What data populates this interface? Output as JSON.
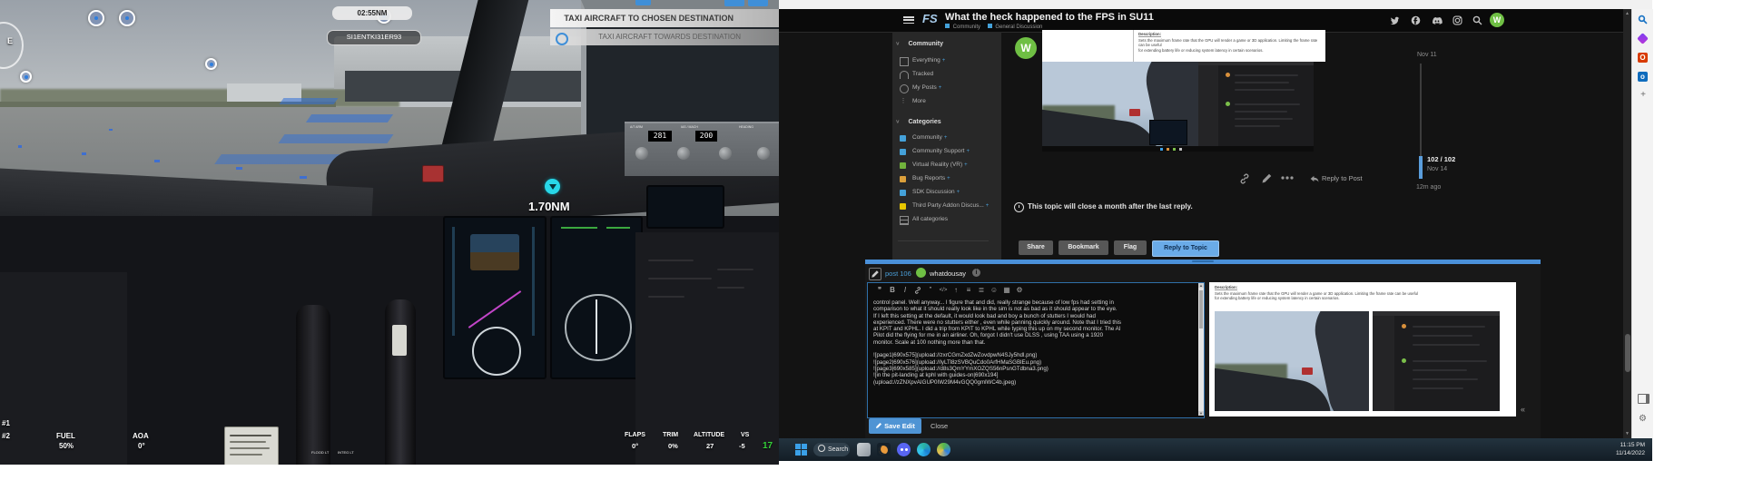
{
  "colors": {
    "accent_blue": "#4a9fd8",
    "category_blue": "#44a1d9",
    "category_green": "#71b33c",
    "category_orange": "#dba03b",
    "category_yellow": "#e7c600",
    "avatar_green": "#6fbf44",
    "reply_button_blue": "#6aabe8",
    "composer_bar_blue": "#4a90d9",
    "taskbar_bg": "#1d2a35",
    "fps_green": "#35d23a"
  },
  "sim": {
    "poi_pill": "02:55NM",
    "route_pill": "SI1ENTKI31ER93",
    "banner_primary": "TAXI AIRCRAFT TO CHOSEN DESTINATION",
    "banner_secondary": "TAXI AIRCRAFT TOWARDS DESTINATION",
    "distance_label": "1.70NM",
    "compass_letter": "E",
    "mcp_course": "281",
    "mcp_ias": "200",
    "mcp_label_1": "A/T ARM",
    "mcp_label_2": "IAS / MACH",
    "mcp_label_3": "HEADING",
    "hud": {
      "flaps_label": "FLAPS",
      "flaps_value": "0°",
      "trim_label": "TRIM",
      "trim_value": "0%",
      "altitude_label": "ALTITUDE",
      "altitude_value": "27",
      "vs_label": "VS",
      "vs_value": "-5"
    },
    "fps_counter": "17",
    "engine1": "#1",
    "engine2": "#2",
    "fuel_label": "FUEL",
    "fuel_value": "50%",
    "aoa_label": "AOA",
    "aoa_value": "0°",
    "panel_flood": "FLOOD LT",
    "panel_integ": "INTEG LT"
  },
  "browser": {
    "header": {
      "logo": "FS",
      "title": "What the heck happened to the FPS in SU11",
      "tag1": "Community",
      "tag2": "General Discussion",
      "avatar_letter": "W"
    },
    "sidebar": {
      "section1_header": "Community",
      "items1": [
        {
          "label": "Everything",
          "suffix": "+"
        },
        {
          "label": "Tracked",
          "suffix": ""
        },
        {
          "label": "My Posts",
          "suffix": "+"
        },
        {
          "label": "More",
          "suffix": ""
        }
      ],
      "section2_header": "Categories",
      "items2": [
        {
          "label": "Community",
          "suffix": "+"
        },
        {
          "label": "Community Support",
          "suffix": "+"
        },
        {
          "label": "Virtual Reality (VR)",
          "suffix": "+"
        },
        {
          "label": "Bug Reports",
          "suffix": "+"
        },
        {
          "label": "SDK Discussion",
          "suffix": "+"
        },
        {
          "label": "Third Party Addon Discus...",
          "suffix": "+"
        },
        {
          "label": "All categories",
          "suffix": ""
        }
      ]
    },
    "post": {
      "avatar_letter": "W",
      "description_heading": "Description:",
      "description_text": "Sets the maximum frame rate that the GPU will render a game or 3D application. Limiting the frame rate can be useful\nfor extending battery life or reducing system latency in certain scenarios.",
      "reply_label": "Reply to Post"
    },
    "notice": "This topic will close a month after the last reply.",
    "topic_buttons": {
      "share": "Share",
      "bookmark": "Bookmark",
      "flag": "Flag",
      "reply": "Reply to Topic"
    },
    "timeline": {
      "start_date": "Nov 11",
      "progress": "102 / 102",
      "end_date": "Nov 14",
      "last_activity": "12m ago"
    },
    "composer": {
      "badge": "post 106",
      "username": "whatdousay",
      "body": "control panel. Well anyway... I figure that and did, really strange because of low fps had setting in\ncomparison to what it should really look like in the sim is not as bad as it should appear to the eye.\nIf I left this setting at the default, it would look bad and boy a bunch of stutters I would had\nexperienced.  There were no stutters either , even while panning quickly around.   Note that I tried this\nat KPIT and KPHL.  I did a trip from KPIT to KPHL while typing this up on my second monitor.  The AI\nPilot did the flying for me in an airliner.    Oh, forgot I didn't use DLSS , using TAA using a 1920\nmonitor.  Scale at 100 nothing more than that.\n\n![page1|690x575](upload://zxrCGmZxdZwZovdpwN4SJy5hdl.png)\n![page2|690x576](upload://lyLTl8zSVBQuCdo0ArfHMaSGBlEu.png)\n![page3|690x585](upload://d8s3QmYYmXOZQS56nPsnGTdbna3.png)\n![in the pit-landing at kphl with guides-on|690x194]\n(upload://zZNXpvAIGUP0IW29M4vGQQ0gmlWC4b.jpeg)",
      "preview_heading": "Description:",
      "preview_text": "Sets the maximum frame rate that the GPU will render a game or 3D application. Limiting the frame rate can be useful\nfor extending battery life or reducing system latency in certain scenarios.",
      "save_label": "Save Edit",
      "close_label": "Close",
      "collapse_label": "«"
    }
  },
  "taskbar": {
    "search_label": "Search",
    "time": "11:15 PM",
    "date": "11/14/2022"
  }
}
